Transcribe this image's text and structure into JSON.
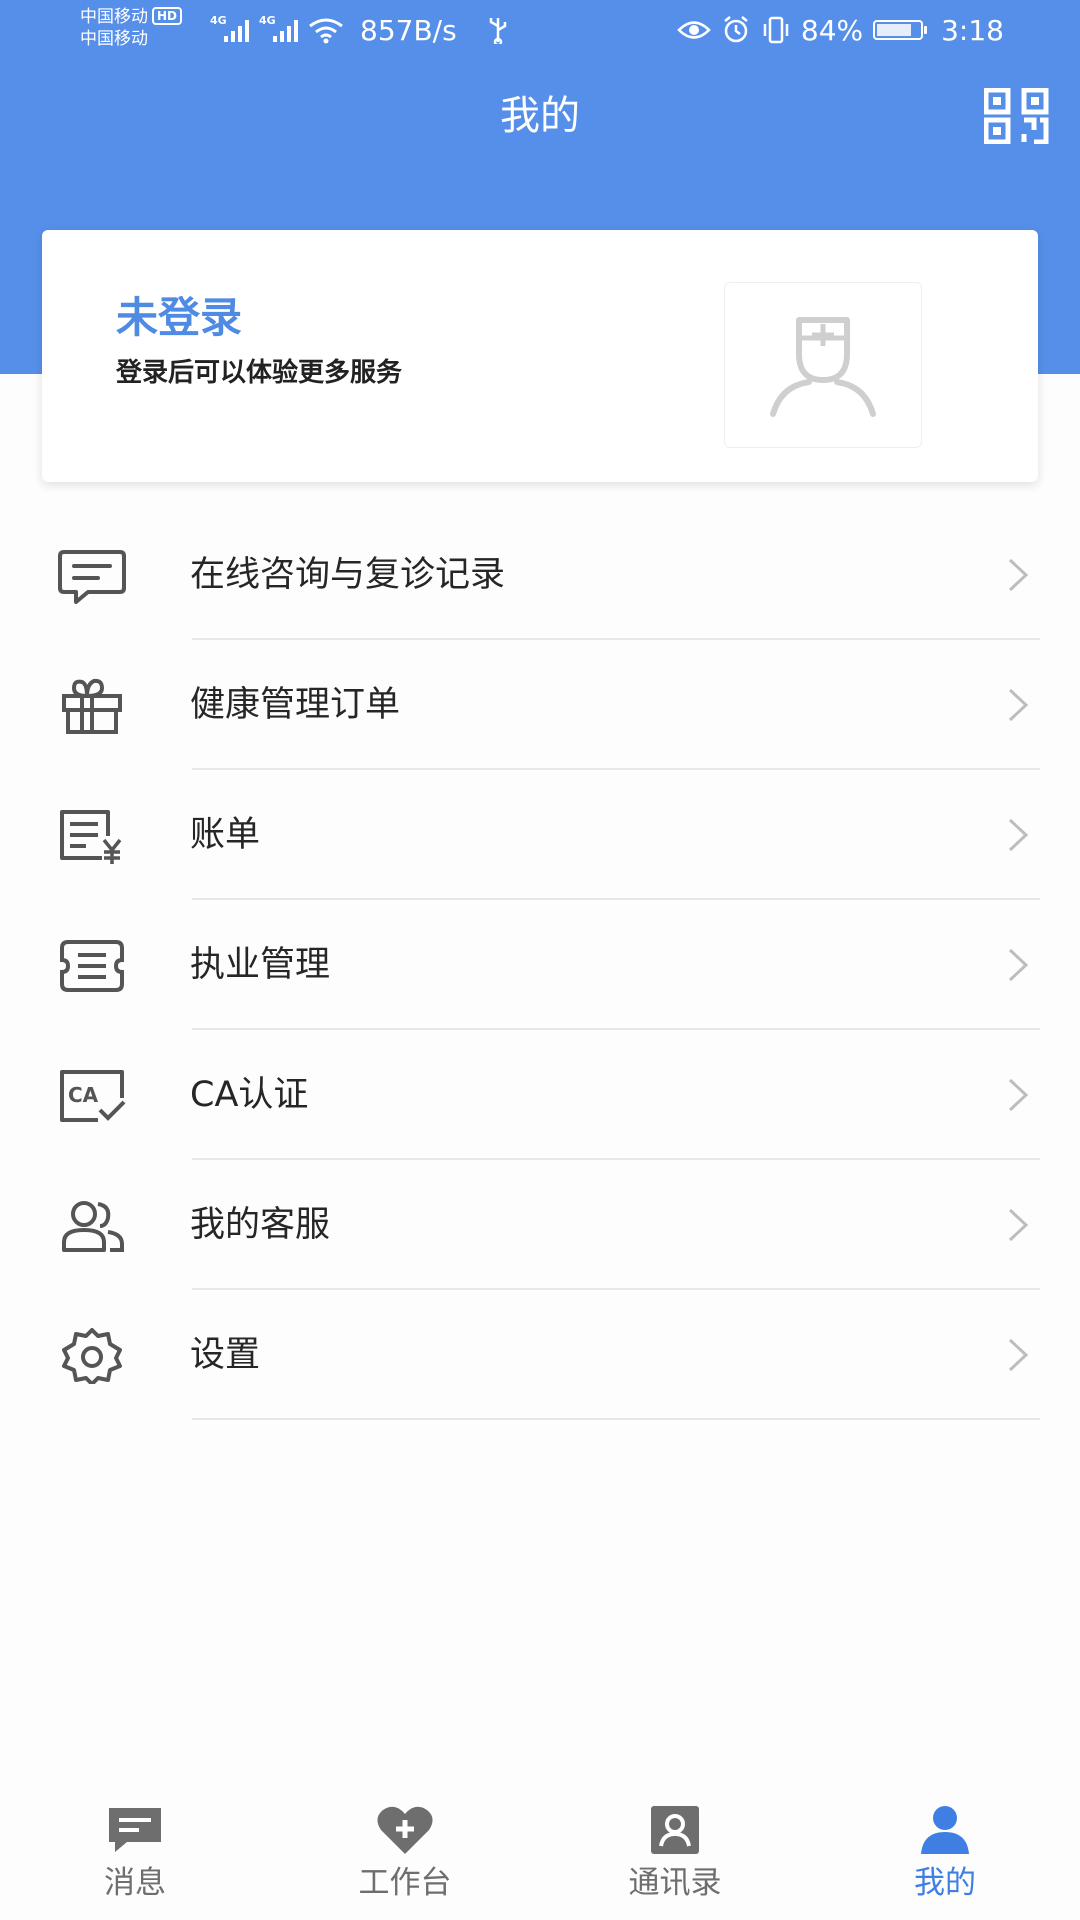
{
  "status_bar": {
    "carrier_1": "中国移动",
    "carrier_2": "中国移动",
    "hd": "HD",
    "net_1": "4G",
    "net_2": "4G",
    "speed": "857B/s",
    "battery": "84%",
    "battery_level": 0.84,
    "time": "3:18"
  },
  "header": {
    "title": "我的"
  },
  "login_card": {
    "title": "未登录",
    "subtitle": "登录后可以体验更多服务"
  },
  "menu": [
    {
      "label": "在线咨询与复诊记录",
      "icon": "chat-icon"
    },
    {
      "label": "健康管理订单",
      "icon": "gift-icon"
    },
    {
      "label": "账单",
      "icon": "bill-yuan-icon"
    },
    {
      "label": "执业管理",
      "icon": "practice-list-icon"
    },
    {
      "label": "CA认证",
      "icon": "ca-certificate-icon"
    },
    {
      "label": "我的客服",
      "icon": "customer-service-icon"
    },
    {
      "label": "设置",
      "icon": "settings-gear-icon"
    }
  ],
  "tabbar": [
    {
      "label": "消息",
      "icon": "message-icon",
      "active": false
    },
    {
      "label": "工作台",
      "icon": "heart-plus-icon",
      "active": false
    },
    {
      "label": "通讯录",
      "icon": "contacts-icon",
      "active": false
    },
    {
      "label": "我的",
      "icon": "person-icon",
      "active": true
    }
  ],
  "colors": {
    "header_bg": "#568fea",
    "accent": "#4f8ae3",
    "tab_active": "#3f7fe4",
    "tab_inactive": "#6e6e6e"
  }
}
